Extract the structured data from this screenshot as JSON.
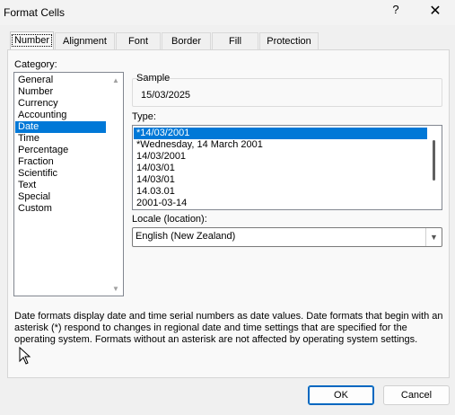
{
  "window": {
    "title": "Format Cells",
    "help_label": "?",
    "close_label": "✕"
  },
  "tabs": [
    {
      "label": "Number",
      "active": true
    },
    {
      "label": "Alignment"
    },
    {
      "label": "Font"
    },
    {
      "label": "Border"
    },
    {
      "label": "Fill"
    },
    {
      "label": "Protection"
    }
  ],
  "category": {
    "label": "Category:",
    "items": [
      "General",
      "Number",
      "Currency",
      "Accounting",
      "Date",
      "Time",
      "Percentage",
      "Fraction",
      "Scientific",
      "Text",
      "Special",
      "Custom"
    ],
    "selected": "Date"
  },
  "sample": {
    "label": "Sample",
    "value": "15/03/2025"
  },
  "type": {
    "label": "Type:",
    "items": [
      "*14/03/2001",
      "*Wednesday, 14 March 2001",
      "14/03/2001",
      "14/03/01",
      "14/03/01",
      "14.03.01",
      "2001-03-14"
    ],
    "selected": "*14/03/2001"
  },
  "locale": {
    "label": "Locale (location):",
    "value": "English (New Zealand)"
  },
  "description": "Date formats display date and time serial numbers as date values.  Date formats that begin with an asterisk (*) respond to changes in regional date and time settings that are specified for the operating system. Formats without an asterisk are not affected by operating system settings.",
  "buttons": {
    "ok": "OK",
    "cancel": "Cancel"
  },
  "colors": {
    "selection": "#0078d7",
    "accent": "#0067c0"
  }
}
